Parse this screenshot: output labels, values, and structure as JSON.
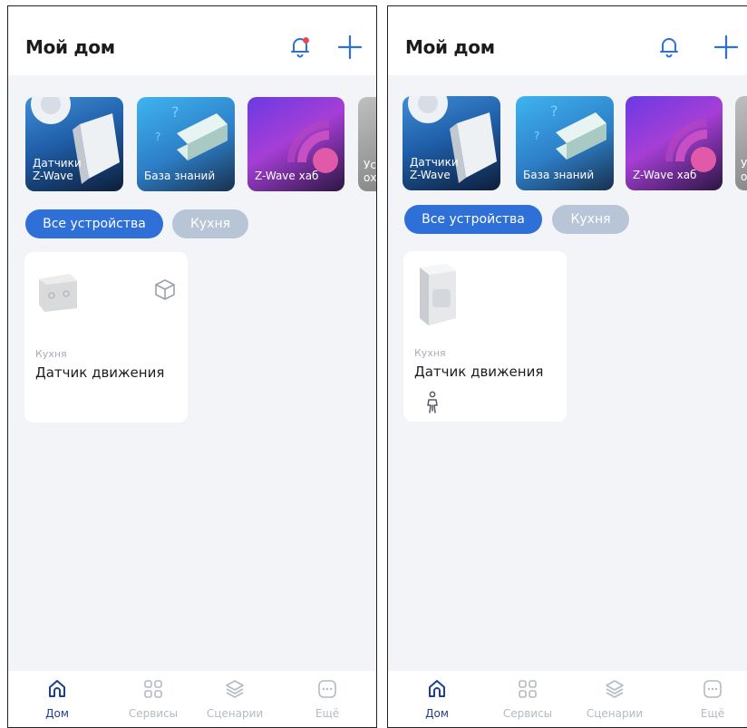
{
  "screens": [
    {
      "header": {
        "title": "Мой дом"
      },
      "stories": [
        {
          "line1": "Датчики",
          "line2": "Z-Wave"
        },
        {
          "line1": "База знаний",
          "line2": ""
        },
        {
          "line1": "Z-Wave хаб",
          "line2": ""
        },
        {
          "line1": "Ус",
          "line2": "ох"
        }
      ],
      "chips": {
        "active": "Все устройства",
        "inactive": "Кухня"
      },
      "device": {
        "room": "Кухня",
        "name": "Датчик движения"
      },
      "tabs": {
        "home": "Дом",
        "services": "Сервисы",
        "scenarios": "Сценарии",
        "more": "Ещё"
      }
    },
    {
      "header": {
        "title": "Мой дом"
      },
      "stories": [
        {
          "line1": "Датчики",
          "line2": "Z-Wave"
        },
        {
          "line1": "База знаний",
          "line2": ""
        },
        {
          "line1": "Z-Wave хаб",
          "line2": ""
        },
        {
          "line1": "У",
          "line2": "о"
        }
      ],
      "chips": {
        "active": "Все устройства",
        "inactive": "Кухня"
      },
      "device": {
        "room": "Кухня",
        "name": "Датчик движения"
      },
      "tabs": {
        "home": "Дом",
        "services": "Сервисы",
        "scenarios": "Сценарии",
        "more": "Ещё"
      }
    }
  ],
  "colors": {
    "accent": "#2f6fd8",
    "chip_inactive": "#b8c5d6",
    "background": "#f2f4f7",
    "notification_dot": "#e5484d",
    "tab_active": "#1c3f8f",
    "tab_inactive": "#b4bac3"
  },
  "icons": [
    "bell-icon",
    "plus-icon",
    "cube-icon",
    "person-walk-icon",
    "home-icon",
    "grid-icon",
    "layers-icon",
    "more-icon"
  ]
}
